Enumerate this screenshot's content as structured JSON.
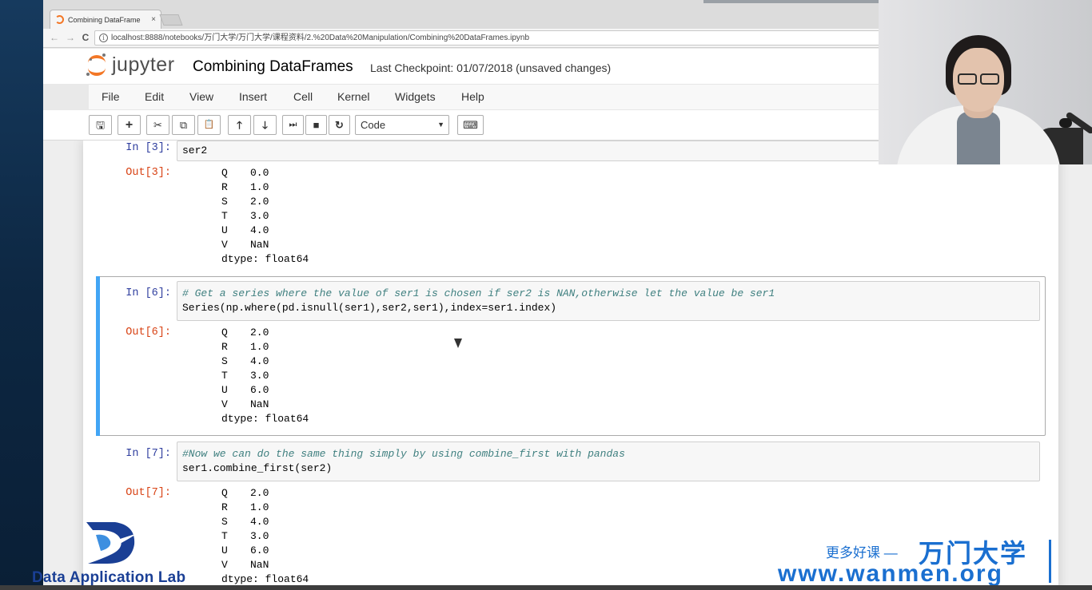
{
  "browser": {
    "tab_title": "Combining DataFrame",
    "tab_close": "×",
    "url": "localhost:8888/notebooks/万门大学/万门大学/课程资料/2.%20Data%20Manipulation/Combining%20DataFrames.ipynb",
    "back_glyph": "←",
    "forward_glyph": "→",
    "reload_glyph": "C",
    "info_glyph": "i"
  },
  "header": {
    "logo_text": "jupyter",
    "notebook_title": "Combining DataFrames",
    "checkpoint": "Last Checkpoint: 01/07/2018 (unsaved changes)"
  },
  "menu": [
    "File",
    "Edit",
    "View",
    "Insert",
    "Cell",
    "Kernel",
    "Widgets",
    "Help"
  ],
  "toolbar": {
    "buttons": [
      {
        "name": "save-icon",
        "glyph": "🖫"
      },
      {
        "name": "add-cell-icon",
        "glyph": "+"
      },
      {
        "name": "cut-icon",
        "glyph": "✂"
      },
      {
        "name": "copy-icon",
        "glyph": "⧉"
      },
      {
        "name": "paste-icon",
        "glyph": "📋"
      },
      {
        "name": "move-up-icon",
        "glyph": "🡑"
      },
      {
        "name": "move-down-icon",
        "glyph": "🡓"
      },
      {
        "name": "run-icon",
        "glyph": "⏭"
      },
      {
        "name": "stop-icon",
        "glyph": "■"
      },
      {
        "name": "restart-icon",
        "glyph": "↻"
      }
    ],
    "cell_type": "Code",
    "select_caret": "▼",
    "keyboard_glyph": "⌨"
  },
  "cells": [
    {
      "in_prompt": "In  [3]:",
      "code": [
        "ser2"
      ],
      "out_prompt": "Out[3]:",
      "output": [
        {
          "idx": "Q",
          "val": "0.0"
        },
        {
          "idx": "R",
          "val": "1.0"
        },
        {
          "idx": "S",
          "val": "2.0"
        },
        {
          "idx": "T",
          "val": "3.0"
        },
        {
          "idx": "U",
          "val": "4.0"
        },
        {
          "idx": "V",
          "val": "NaN"
        }
      ],
      "dtype": "dtype: float64"
    },
    {
      "in_prompt": "In  [6]:",
      "comment": "# Get a series where the value of ser1 is chosen if ser2 is NAN,otherwise let the value be ser1",
      "code": [
        "Series(np.where(pd.isnull(ser1),ser2,ser1),index=ser1.index)"
      ],
      "out_prompt": "Out[6]:",
      "output": [
        {
          "idx": "Q",
          "val": "2.0"
        },
        {
          "idx": "R",
          "val": "1.0"
        },
        {
          "idx": "S",
          "val": "4.0"
        },
        {
          "idx": "T",
          "val": "3.0"
        },
        {
          "idx": "U",
          "val": "6.0"
        },
        {
          "idx": "V",
          "val": "NaN"
        }
      ],
      "dtype": "dtype: float64"
    },
    {
      "in_prompt": "In  [7]:",
      "comment": "#Now we can do the same thing simply by using combine_first with pandas",
      "code": [
        "ser1.combine_first(ser2)"
      ],
      "out_prompt": "Out[7]:",
      "output": [
        {
          "idx": "Q",
          "val": "2.0"
        },
        {
          "idx": "R",
          "val": "1.0"
        },
        {
          "idx": "S",
          "val": "4.0"
        },
        {
          "idx": "T",
          "val": "3.0"
        },
        {
          "idx": "U",
          "val": "6.0"
        },
        {
          "idx": "V",
          "val": "NaN"
        }
      ],
      "dtype": "dtype: float64"
    }
  ],
  "watermarks": {
    "dal": "Data Application Lab",
    "slogan": "更多好课 —",
    "brand": "万门大学",
    "url": "www.wanmen.org"
  },
  "colors": {
    "jupyter_orange": "#f37726",
    "selected_cell_bar": "#42a5f5",
    "in_prompt": "#303f9f",
    "out_prompt": "#d84315",
    "watermark_blue": "#1a6fd0"
  }
}
